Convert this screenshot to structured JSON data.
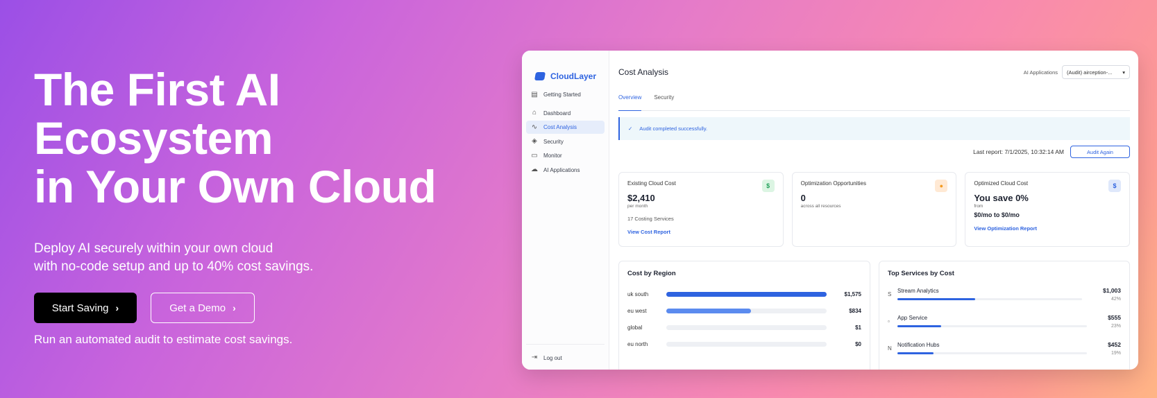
{
  "hero": {
    "title_lines": [
      "The First AI",
      "Ecosystem",
      "in Your Own Cloud"
    ],
    "subtitle_lines": [
      "Deploy AI securely within your own cloud",
      "with no-code setup and up to 40% cost savings."
    ],
    "primary_cta": "Start Saving",
    "secondary_cta": "Get a Demo",
    "note": "Run an automated audit to estimate cost savings."
  },
  "app": {
    "brand": "CloudLayer",
    "nav": [
      {
        "label": "Getting Started",
        "icon": "clipboard-icon"
      },
      {
        "label": "Dashboard",
        "icon": "home-icon"
      },
      {
        "label": "Cost Analysis",
        "icon": "trend-icon",
        "active": true
      },
      {
        "label": "Security",
        "icon": "shield-icon"
      },
      {
        "label": "Monitor",
        "icon": "monitor-icon"
      },
      {
        "label": "AI Applications",
        "icon": "cloud-icon"
      }
    ],
    "logout": "Log out",
    "title": "Cost Analysis",
    "app_select_label": "AI Applications",
    "app_select_value": "(Audit) airception-...",
    "tabs": [
      "Overview",
      "Security"
    ],
    "alert": "Audit completed successfully.",
    "last_report": "Last report: 7/1/2025, 10:32:14 AM",
    "audit_again": "Audit Again",
    "cards": [
      {
        "title": "Existing Cloud Cost",
        "value": "$2,410",
        "sub": "per month",
        "extra": "17 Costing Services",
        "link": "View Cost Report",
        "badge": "$"
      },
      {
        "title": "Optimization Opportunities",
        "value": "0",
        "sub": "across all resources",
        "badge": "bulb"
      },
      {
        "title": "Optimized Cloud Cost",
        "value": "You save 0%",
        "sub": "from",
        "range": "$0/mo to $0/mo",
        "link": "View Optimization Report",
        "badge": "$"
      }
    ],
    "colors": {
      "accent": "#2e63e0",
      "accent_light": "#5b8bef"
    },
    "region_panel_title": "Cost by Region",
    "regions": [
      {
        "name": "uk south",
        "value": "$1,575",
        "fraction": 1.0
      },
      {
        "name": "eu west",
        "value": "$834",
        "fraction": 0.53
      },
      {
        "name": "global",
        "value": "$1",
        "fraction": 0.0
      },
      {
        "name": "eu north",
        "value": "$0",
        "fraction": 0.0
      }
    ],
    "services_panel_title": "Top Services by Cost",
    "services": [
      {
        "icon": "S",
        "name": "Stream Analytics",
        "cost": "$1,003",
        "pct": "42%",
        "fraction": 0.42
      },
      {
        "icon": "img",
        "name": "App Service",
        "cost": "$555",
        "pct": "23%",
        "fraction": 0.23
      },
      {
        "icon": "N",
        "name": "Notification Hubs",
        "cost": "$452",
        "pct": "19%",
        "fraction": 0.19
      }
    ]
  }
}
